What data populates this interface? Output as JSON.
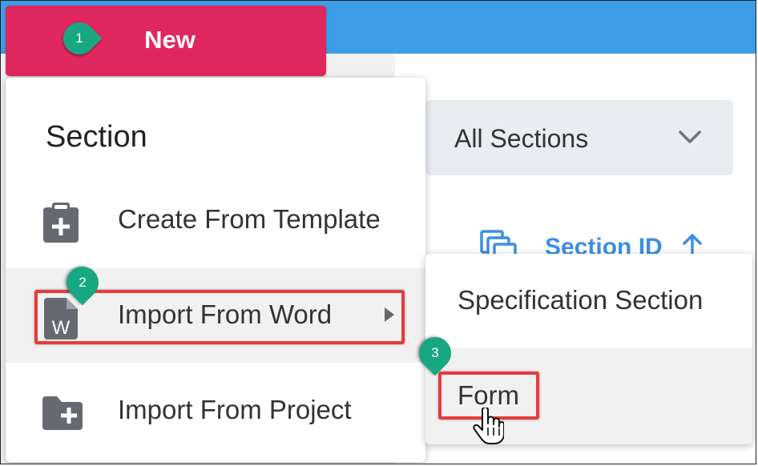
{
  "header": {
    "new_button_label": "New",
    "accent_color": "#e0275d",
    "bar_color": "#3d9ee8"
  },
  "filter": {
    "selected": "All Sections",
    "icon": "chevron-down-icon"
  },
  "table": {
    "column_header": "Section ID",
    "sort_icon": "arrow-up-icon",
    "column_icon": "stacked-copies-icon"
  },
  "menu": {
    "heading": "Section",
    "items": [
      {
        "label": "Create From Template",
        "icon": "clipboard-plus-icon"
      },
      {
        "label": "Import From Word",
        "icon": "word-file-icon",
        "icon_letter": "W",
        "has_submenu": true
      },
      {
        "label": "Import From Project",
        "icon": "folder-plus-icon"
      }
    ]
  },
  "submenu": {
    "items": [
      {
        "label": "Specification Section"
      },
      {
        "label": "Form"
      }
    ]
  },
  "callouts": [
    "1",
    "2",
    "3"
  ],
  "highlight_color": "#e63b3b",
  "callout_color": "#17a783"
}
